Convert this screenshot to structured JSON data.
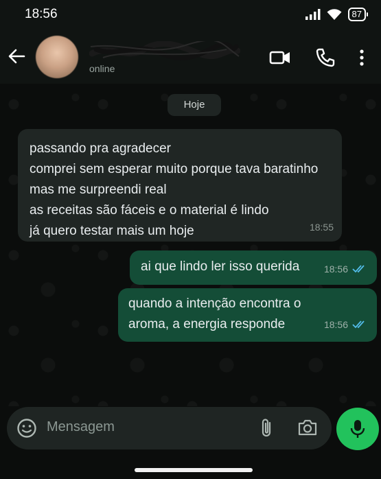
{
  "status_bar": {
    "time": "18:56",
    "battery": "87"
  },
  "header": {
    "contact_status": "online",
    "icons": [
      "back-arrow-icon",
      "video-call-icon",
      "phone-call-icon",
      "more-vertical-icon"
    ]
  },
  "chat": {
    "date_label": "Hoje",
    "messages": [
      {
        "direction": "in",
        "lines": [
          "passando pra agradecer",
          "comprei sem esperar muito porque tava baratinho",
          "mas me surpreendi real",
          "as receitas são fáceis e o material é lindo",
          "já quero testar mais um hoje"
        ],
        "time": "18:55"
      },
      {
        "direction": "out",
        "lines": [
          "ai que lindo ler isso querida"
        ],
        "time": "18:56",
        "status": "read"
      },
      {
        "direction": "out",
        "lines": [
          "quando a intenção encontra o",
          "aroma, a energia responde"
        ],
        "time": "18:56",
        "status": "read"
      }
    ]
  },
  "composer": {
    "placeholder": "Mensagem",
    "icons": [
      "emoji-icon",
      "attach-icon",
      "camera-icon",
      "mic-icon"
    ]
  },
  "colors": {
    "accent": "#22c25c",
    "outgoing_bubble": "#144d37",
    "incoming_bubble": "#202624",
    "read_ticks": "#53bdeb"
  }
}
